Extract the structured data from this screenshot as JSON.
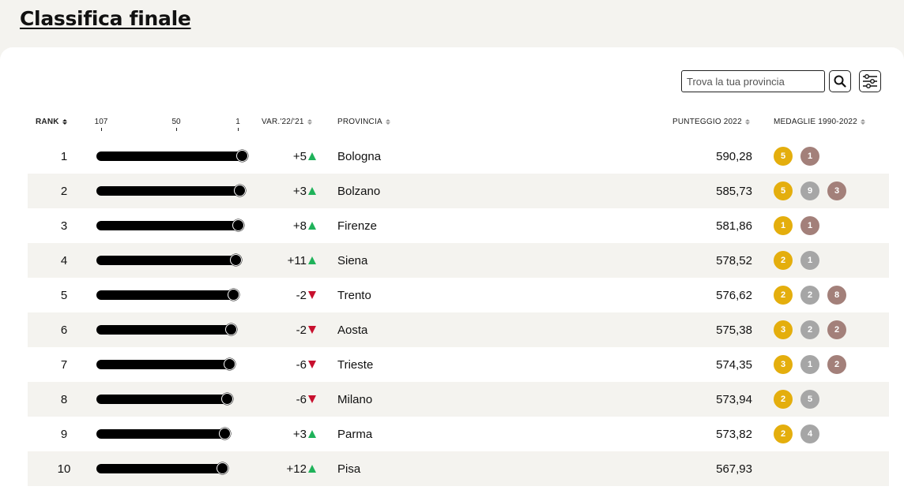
{
  "page": {
    "title": "Classifica finale"
  },
  "search": {
    "placeholder": "Trova la tua provincia"
  },
  "icons": {
    "search": "search-icon",
    "filter": "filter-sliders-icon",
    "sort": "sort-icon"
  },
  "colors": {
    "gold": "#e4ae0d",
    "silver": "#a6a6a6",
    "bronze": "#a3807a",
    "up": "#1fb25a",
    "down": "#c8102e",
    "shaded_row": "#f4f3ef"
  },
  "table": {
    "headers": {
      "rank": "RANK",
      "variation": "VAR.'22/'21",
      "province": "PROVINCIA",
      "score": "PUNTEGGIO 2022",
      "medals": "MEDAGLIE 1990-2022"
    },
    "scale": {
      "left": "107",
      "mid": "50",
      "right": "1",
      "max_rank": 107
    },
    "rows": [
      {
        "rank": "1",
        "var": "+5",
        "dir": "up",
        "province": "Bologna",
        "score": "590,28",
        "medals": [
          {
            "type": "gold",
            "count": "5"
          },
          {
            "type": "bronze",
            "count": "1"
          }
        ]
      },
      {
        "rank": "2",
        "var": "+3",
        "dir": "up",
        "province": "Bolzano",
        "score": "585,73",
        "medals": [
          {
            "type": "gold",
            "count": "5"
          },
          {
            "type": "silver",
            "count": "9"
          },
          {
            "type": "bronze",
            "count": "3"
          }
        ]
      },
      {
        "rank": "3",
        "var": "+8",
        "dir": "up",
        "province": "Firenze",
        "score": "581,86",
        "medals": [
          {
            "type": "gold",
            "count": "1"
          },
          {
            "type": "bronze",
            "count": "1"
          }
        ]
      },
      {
        "rank": "4",
        "var": "+11",
        "dir": "up",
        "province": "Siena",
        "score": "578,52",
        "medals": [
          {
            "type": "gold",
            "count": "2"
          },
          {
            "type": "silver",
            "count": "1"
          }
        ]
      },
      {
        "rank": "5",
        "var": "-2",
        "dir": "down",
        "province": "Trento",
        "score": "576,62",
        "medals": [
          {
            "type": "gold",
            "count": "2"
          },
          {
            "type": "silver",
            "count": "2"
          },
          {
            "type": "bronze",
            "count": "8"
          }
        ]
      },
      {
        "rank": "6",
        "var": "-2",
        "dir": "down",
        "province": "Aosta",
        "score": "575,38",
        "medals": [
          {
            "type": "gold",
            "count": "3"
          },
          {
            "type": "silver",
            "count": "2"
          },
          {
            "type": "bronze",
            "count": "2"
          }
        ]
      },
      {
        "rank": "7",
        "var": "-6",
        "dir": "down",
        "province": "Trieste",
        "score": "574,35",
        "medals": [
          {
            "type": "gold",
            "count": "3"
          },
          {
            "type": "silver",
            "count": "1"
          },
          {
            "type": "bronze",
            "count": "2"
          }
        ]
      },
      {
        "rank": "8",
        "var": "-6",
        "dir": "down",
        "province": "Milano",
        "score": "573,94",
        "medals": [
          {
            "type": "gold",
            "count": "2"
          },
          {
            "type": "silver",
            "count": "5"
          }
        ]
      },
      {
        "rank": "9",
        "var": "+3",
        "dir": "up",
        "province": "Parma",
        "score": "573,82",
        "medals": [
          {
            "type": "gold",
            "count": "2"
          },
          {
            "type": "silver",
            "count": "4"
          }
        ]
      },
      {
        "rank": "10",
        "var": "+12",
        "dir": "up",
        "province": "Pisa",
        "score": "567,93",
        "medals": []
      }
    ]
  }
}
